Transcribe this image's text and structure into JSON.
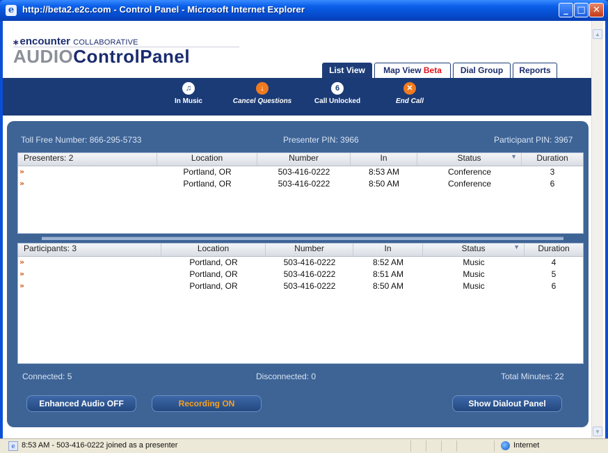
{
  "window": {
    "title": "http://beta2.e2c.com - Control Panel - Microsoft Internet Explorer",
    "buttons": {
      "minimize": "_",
      "maximize": "□",
      "close": "✕"
    }
  },
  "brand": {
    "mark": "⁎",
    "name": "encounter",
    "collab": "COLLABORATIVE",
    "product_a": "AUDIO",
    "product_b": "ControlPanel"
  },
  "tabs": [
    {
      "label": "List View",
      "active": true
    },
    {
      "label": "Map View",
      "suffix": "Beta",
      "active": false
    },
    {
      "label": "Dial Group",
      "active": false
    },
    {
      "label": "Reports",
      "active": false
    }
  ],
  "toolbar": {
    "items": [
      {
        "label": "In Music",
        "icon": "music-note-icon",
        "glyph": "♫"
      },
      {
        "label": "Cancel Questions",
        "icon": "arrow-down-icon",
        "glyph": "↓"
      },
      {
        "label": "Call Unlocked",
        "icon": "unlock-icon",
        "glyph": "6"
      },
      {
        "label": "End Call",
        "icon": "end-call-icon",
        "glyph": "✕"
      }
    ]
  },
  "info": {
    "toll_free": "Toll Free Number: 866-295-5733",
    "presenter_pin": "Presenter PIN: 3966",
    "participant_pin": "Participant PIN: 3967"
  },
  "presenters": {
    "headers": [
      "Presenters: 2",
      "Location",
      "Number",
      "In",
      "Status",
      "Duration"
    ],
    "rows": [
      {
        "location": "Portland, OR",
        "number": "503-416-0222",
        "in": "8:53 AM",
        "status": "Conference",
        "duration": "3"
      },
      {
        "location": "Portland, OR",
        "number": "503-416-0222",
        "in": "8:50 AM",
        "status": "Conference",
        "duration": "6"
      }
    ]
  },
  "participants": {
    "headers": [
      "Participants: 3",
      "Location",
      "Number",
      "In",
      "Status",
      "Duration"
    ],
    "rows": [
      {
        "location": "Portland, OR",
        "number": "503-416-0222",
        "in": "8:52 AM",
        "status": "Music",
        "duration": "4"
      },
      {
        "location": "Portland, OR",
        "number": "503-416-0222",
        "in": "8:51 AM",
        "status": "Music",
        "duration": "5"
      },
      {
        "location": "Portland, OR",
        "number": "503-416-0222",
        "in": "8:50 AM",
        "status": "Music",
        "duration": "6"
      }
    ]
  },
  "summary": {
    "connected": "Connected: 5",
    "disconnected": "Disconnected: 0",
    "total_minutes": "Total Minutes: 22"
  },
  "buttons": {
    "enhanced_audio": "Enhanced Audio OFF",
    "recording": "Recording ON",
    "show_dialout": "Show Dialout Panel"
  },
  "statusbar": {
    "message": "8:53 AM - 503-416-0222 joined as a presenter",
    "zone": "Internet"
  },
  "colors": {
    "navy": "#1b3b76",
    "panel_blue": "#3e6496",
    "orange": "#f07a1e",
    "beta_red": "#e0151b"
  }
}
